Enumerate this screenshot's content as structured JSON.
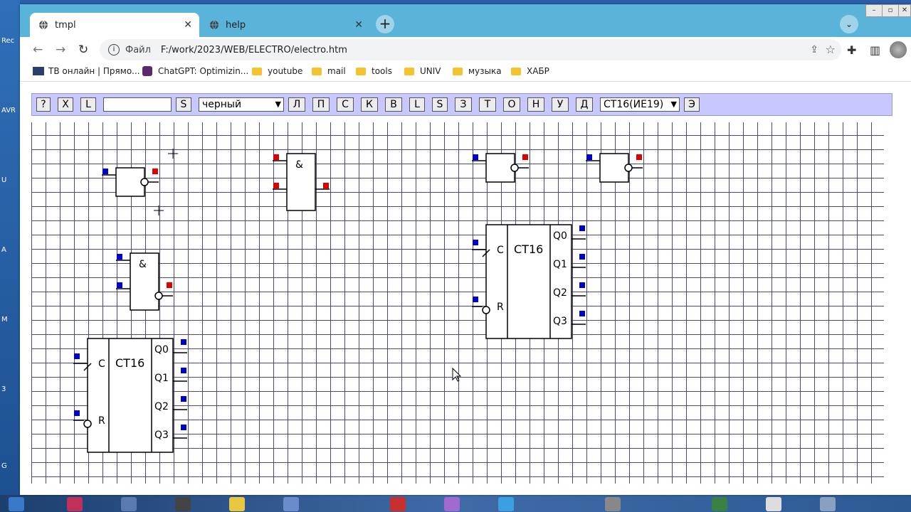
{
  "desktop": {
    "left_labels": [
      "Rec",
      "AVR",
      "U",
      "A",
      "M",
      "3",
      "G"
    ]
  },
  "tabs": [
    {
      "title": "tmpl",
      "active": true
    },
    {
      "title": "help",
      "active": false
    }
  ],
  "address": {
    "scheme_label": "Файл",
    "url": "F:/work/2023/WEB/ELECTRO/electro.htm"
  },
  "bookmarks": [
    {
      "label": "ТВ онлайн | Прямо...",
      "icon": "tv-icon"
    },
    {
      "label": "ChatGPT: Optimizin...",
      "icon": "chatgpt-icon"
    },
    {
      "label": "youtube",
      "icon": "folder-icon"
    },
    {
      "label": "mail",
      "icon": "folder-icon"
    },
    {
      "label": "tools",
      "icon": "folder-icon"
    },
    {
      "label": "UNIV",
      "icon": "folder-icon"
    },
    {
      "label": "музыка",
      "icon": "folder-icon"
    },
    {
      "label": "ХАБР",
      "icon": "folder-icon"
    }
  ],
  "toolbar": {
    "help": "?",
    "x": "X",
    "l1": "L",
    "text_value": "",
    "s1": "S",
    "color_select": "черный",
    "buttons": [
      "Л",
      "П",
      "С",
      "К",
      "В",
      "L",
      "S",
      "З",
      "Т",
      "О",
      "Н",
      "У",
      "Д"
    ],
    "component_select": "СТ16(ИЕ19)",
    "last": "Э"
  },
  "schematic": {
    "and_symbol": "&",
    "counter_label": "СТ16",
    "pin_c": "C",
    "pin_r": "R",
    "outputs": [
      "Q0",
      "Q1",
      "Q2",
      "Q3"
    ],
    "colors": {
      "input_pin": "#0000cc",
      "output_pin": "#dd0000",
      "wire": "#000000"
    }
  }
}
